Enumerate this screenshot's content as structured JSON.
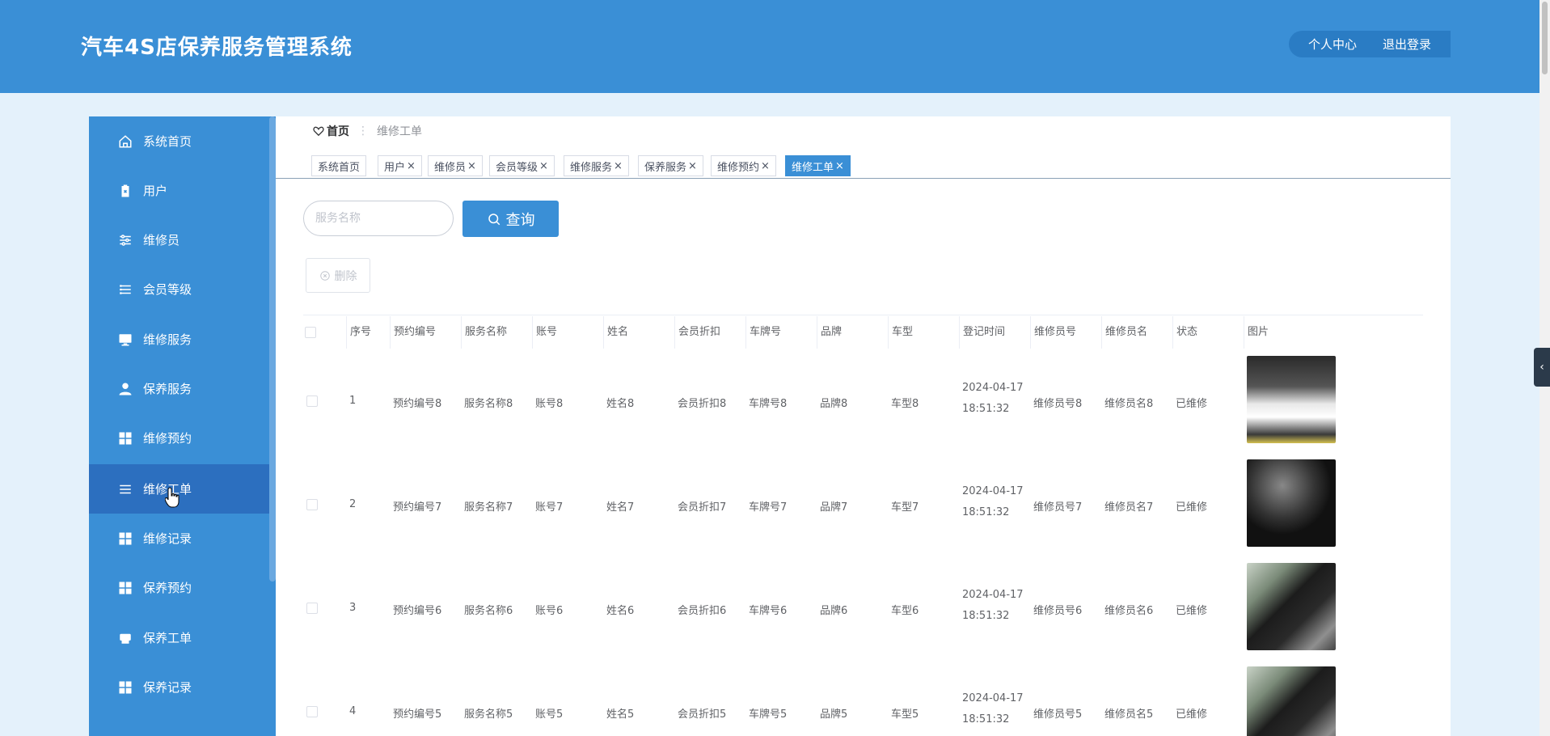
{
  "header": {
    "app_title": "汽车4S店保养服务管理系统",
    "personal_center": "个人中心",
    "logout": "退出登录"
  },
  "sidebar": {
    "items": [
      {
        "label": "系统首页",
        "icon": "home-icon"
      },
      {
        "label": "用户",
        "icon": "clipboard-icon"
      },
      {
        "label": "维修员",
        "icon": "sliders-icon"
      },
      {
        "label": "会员等级",
        "icon": "list-icon"
      },
      {
        "label": "维修服务",
        "icon": "monitor-icon"
      },
      {
        "label": "保养服务",
        "icon": "user-icon"
      },
      {
        "label": "维修预约",
        "icon": "grid-icon"
      },
      {
        "label": "维修工单",
        "icon": "menu-icon",
        "active": true
      },
      {
        "label": "维修记录",
        "icon": "grid-icon"
      },
      {
        "label": "保养预约",
        "icon": "grid-icon"
      },
      {
        "label": "保养工单",
        "icon": "printer-icon"
      },
      {
        "label": "保养记录",
        "icon": "grid-icon"
      }
    ]
  },
  "breadcrumb": {
    "home": "首页",
    "separator": "⋮",
    "current": "维修工单"
  },
  "tabs": [
    {
      "label": "系统首页",
      "closable": false
    },
    {
      "label": "用户",
      "closable": true
    },
    {
      "label": "维修员",
      "closable": true
    },
    {
      "label": "会员等级",
      "closable": true
    },
    {
      "label": "维修服务",
      "closable": true
    },
    {
      "label": "保养服务",
      "closable": true
    },
    {
      "label": "维修预约",
      "closable": true
    },
    {
      "label": "维修工单",
      "closable": true,
      "active": true
    }
  ],
  "tab_close_glyph": "×",
  "search": {
    "placeholder": "服务名称",
    "button_label": "查询"
  },
  "delete_label": "删除",
  "table": {
    "columns": [
      "序号",
      "预约编号",
      "服务名称",
      "账号",
      "姓名",
      "会员折扣",
      "车牌号",
      "品牌",
      "车型",
      "登记时间",
      "维修员号",
      "维修员名",
      "状态",
      "图片"
    ],
    "rows": [
      {
        "index": "1",
        "booking_no": "预约编号8",
        "service": "服务名称8",
        "account": "账号8",
        "name": "姓名8",
        "discount": "会员折扣8",
        "plate": "车牌号8",
        "brand": "品牌8",
        "model": "车型8",
        "date": "2024-04-17",
        "time": "18:51:32",
        "tech_no": "维修员号8",
        "tech_name": "维修员名8",
        "status": "已维修"
      },
      {
        "index": "2",
        "booking_no": "预约编号7",
        "service": "服务名称7",
        "account": "账号7",
        "name": "姓名7",
        "discount": "会员折扣7",
        "plate": "车牌号7",
        "brand": "品牌7",
        "model": "车型7",
        "date": "2024-04-17",
        "time": "18:51:32",
        "tech_no": "维修员号7",
        "tech_name": "维修员名7",
        "status": "已维修"
      },
      {
        "index": "3",
        "booking_no": "预约编号6",
        "service": "服务名称6",
        "account": "账号6",
        "name": "姓名6",
        "discount": "会员折扣6",
        "plate": "车牌号6",
        "brand": "品牌6",
        "model": "车型6",
        "date": "2024-04-17",
        "time": "18:51:32",
        "tech_no": "维修员号6",
        "tech_name": "维修员名6",
        "status": "已维修"
      },
      {
        "index": "4",
        "booking_no": "预约编号5",
        "service": "服务名称5",
        "account": "账号5",
        "name": "姓名5",
        "discount": "会员折扣5",
        "plate": "车牌号5",
        "brand": "品牌5",
        "model": "车型5",
        "date": "2024-04-17",
        "time": "18:51:32",
        "tech_no": "维修员号5",
        "tech_name": "维修员名5",
        "status": "已维修"
      }
    ]
  },
  "colors": {
    "primary": "#3a8fd6",
    "primary_dark": "#2c6fbf",
    "page_bg": "#e4f1fb"
  }
}
